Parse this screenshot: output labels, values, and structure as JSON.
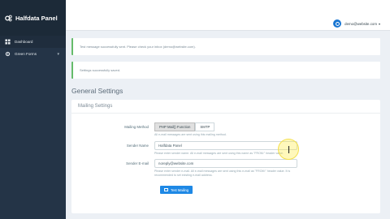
{
  "brand": {
    "title": "Halfdata Panel"
  },
  "sidebar": {
    "items": [
      {
        "label": "Dashboard",
        "icon": "dashboard-icon"
      },
      {
        "label": "Green Forms",
        "icon": "gear-icon",
        "has_submenu": true
      }
    ]
  },
  "topbar": {
    "user_email": "demo@website.com"
  },
  "alerts": [
    {
      "text": "Test message successfully sent. Please check your inbox (demo@website.com)."
    },
    {
      "text": "Settings successfully saved."
    }
  ],
  "section": {
    "title": "General Settings"
  },
  "mailing": {
    "card_title": "Mailing Settings",
    "method": {
      "label": "Mailing Method",
      "options": [
        "PHP Mail() Function",
        "SMTP"
      ],
      "selected": "PHP Mail() Function",
      "help": "All e-mail messages are sent using this mailing method."
    },
    "sender_name": {
      "label": "Sender Name",
      "value": "Halfdata Panel",
      "help": "Please enter sender name. All e-mail messages are sent using this name as \"FROM:\" header value."
    },
    "sender_email": {
      "label": "Sender E-mail",
      "value": "noreply@website.com",
      "help": "Please enter sender e-mail. All e-mail messages are sent using this e-mail as \"FROM:\" header value. It is recommended to set existing e-mail address."
    },
    "test_button": {
      "label": "Test Mailing"
    }
  },
  "colors": {
    "sidebar": "#243447",
    "accent": "#1e88e5",
    "success": "#66bb6a",
    "cursor_highlight": "#f4e04d"
  }
}
